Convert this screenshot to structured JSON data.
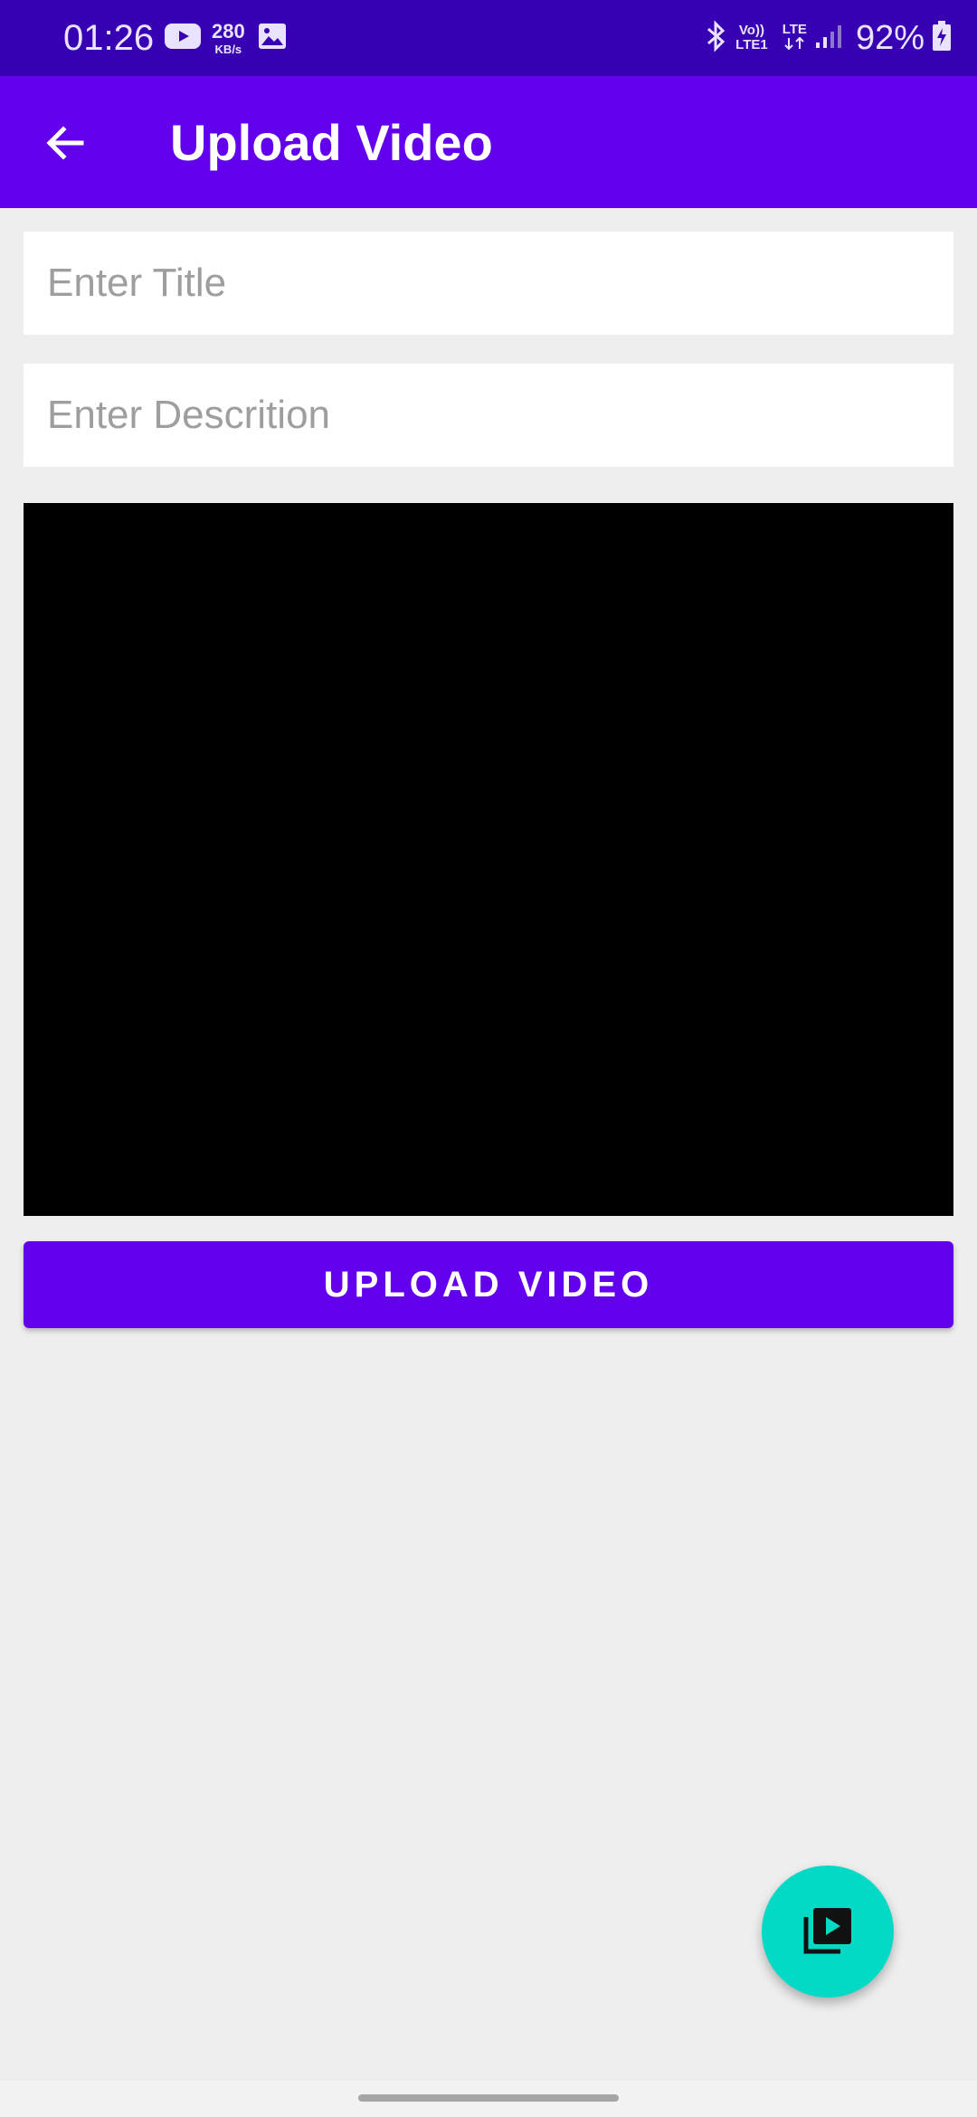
{
  "status_bar": {
    "time": "01:26",
    "net_speed_value": "280",
    "net_speed_unit": "KB/s",
    "volte_top": "Vo))",
    "volte_bottom": "LTE1",
    "lte_label": "LTE",
    "battery_percent": "92%",
    "icons": [
      "youtube-icon",
      "image-icon",
      "bluetooth-icon",
      "signal-icon",
      "battery-charging-icon"
    ]
  },
  "app_bar": {
    "title": "Upload Video",
    "back_icon": "arrow-back-icon"
  },
  "form": {
    "title_placeholder": "Enter Title",
    "title_value": "",
    "description_placeholder": "Enter Descrition",
    "description_value": ""
  },
  "upload_button": {
    "label": "UPLOAD VIDEO"
  },
  "fab": {
    "icon": "video-library-icon"
  },
  "colors": {
    "status_bar": "#3700b3",
    "primary": "#6200ee",
    "accent": "#03dac5",
    "background": "#eeeeee"
  }
}
